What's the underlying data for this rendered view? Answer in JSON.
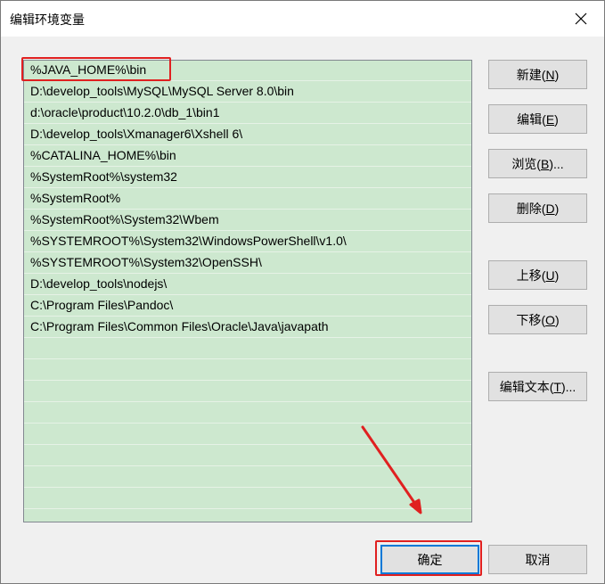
{
  "window": {
    "title": "编辑环境变量",
    "close_icon": "close-icon"
  },
  "path_list": {
    "items": [
      "%JAVA_HOME%\\bin",
      "D:\\develop_tools\\MySQL\\MySQL Server 8.0\\bin",
      "d:\\oracle\\product\\10.2.0\\db_1\\bin1",
      "D:\\develop_tools\\Xmanager6\\Xshell 6\\",
      "%CATALINA_HOME%\\bin",
      "%SystemRoot%\\system32",
      "%SystemRoot%",
      "%SystemRoot%\\System32\\Wbem",
      "%SYSTEMROOT%\\System32\\WindowsPowerShell\\v1.0\\",
      "%SYSTEMROOT%\\System32\\OpenSSH\\",
      "D:\\develop_tools\\nodejs\\",
      "C:\\Program Files\\Pandoc\\",
      "C:\\Program Files\\Common Files\\Oracle\\Java\\javapath"
    ],
    "empty_rows": 9,
    "background": "#cde8cf"
  },
  "buttons": {
    "new": {
      "text": "新建(",
      "key": "N",
      "end": ")"
    },
    "edit": {
      "text": "编辑(",
      "key": "E",
      "end": ")"
    },
    "browse": {
      "text": "浏览(",
      "key": "B",
      "end": ")..."
    },
    "delete": {
      "text": "删除(",
      "key": "D",
      "end": ")"
    },
    "move_up": {
      "text": "上移(",
      "key": "U",
      "end": ")"
    },
    "move_down": {
      "text": "下移(",
      "key": "O",
      "end": ")"
    },
    "edit_text": {
      "text": "编辑文本(",
      "key": "T",
      "end": ")..."
    },
    "ok": "确定",
    "cancel": "取消"
  },
  "annotation_color": "#e02020"
}
